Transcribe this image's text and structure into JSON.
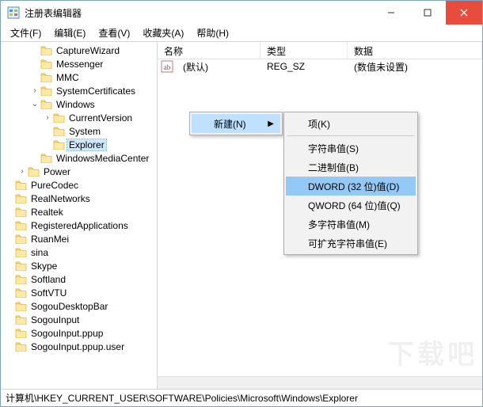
{
  "title": "注册表编辑器",
  "menu": {
    "file": "文件(F)",
    "edit": "编辑(E)",
    "view": "查看(V)",
    "favorites": "收藏夹(A)",
    "help": "帮助(H)"
  },
  "tree": [
    {
      "level": 2,
      "expander": "",
      "label": "CaptureWizard"
    },
    {
      "level": 2,
      "expander": "",
      "label": "Messenger"
    },
    {
      "level": 2,
      "expander": "",
      "label": "MMC"
    },
    {
      "level": 2,
      "expander": ">",
      "label": "SystemCertificates"
    },
    {
      "level": 2,
      "expander": "v",
      "label": "Windows"
    },
    {
      "level": 3,
      "expander": ">",
      "label": "CurrentVersion"
    },
    {
      "level": 3,
      "expander": "",
      "label": "System"
    },
    {
      "level": 3,
      "expander": "",
      "label": "Explorer",
      "selected": true
    },
    {
      "level": 2,
      "expander": "",
      "label": "WindowsMediaCenter"
    },
    {
      "level": 1,
      "expander": ">",
      "label": "Power"
    },
    {
      "level": 0,
      "expander": "",
      "label": "PureCodec"
    },
    {
      "level": 0,
      "expander": "",
      "label": "RealNetworks"
    },
    {
      "level": 0,
      "expander": "",
      "label": "Realtek"
    },
    {
      "level": 0,
      "expander": "",
      "label": "RegisteredApplications"
    },
    {
      "level": 0,
      "expander": "",
      "label": "RuanMei"
    },
    {
      "level": 0,
      "expander": "",
      "label": "sina"
    },
    {
      "level": 0,
      "expander": "",
      "label": "Skype"
    },
    {
      "level": 0,
      "expander": "",
      "label": "Softland"
    },
    {
      "level": 0,
      "expander": "",
      "label": "SoftVTU"
    },
    {
      "level": 0,
      "expander": "",
      "label": "SogouDesktopBar"
    },
    {
      "level": 0,
      "expander": "",
      "label": "SogouInput"
    },
    {
      "level": 0,
      "expander": "",
      "label": "SogouInput.ppup"
    },
    {
      "level": 0,
      "expander": "",
      "label": "SogouInput.ppup.user"
    }
  ],
  "columns": {
    "name": "名称",
    "type": "类型",
    "data": "数据"
  },
  "rows": [
    {
      "name": "(默认)",
      "type": "REG_SZ",
      "data": "(数值未设置)"
    }
  ],
  "context_primary": {
    "new": "新建(N)"
  },
  "context_sub": {
    "key": "项(K)",
    "string": "字符串值(S)",
    "binary": "二进制值(B)",
    "dword": "DWORD (32 位)值(D)",
    "qword": "QWORD (64 位)值(Q)",
    "multi": "多字符串值(M)",
    "expand": "可扩充字符串值(E)"
  },
  "statusbar": "计算机\\HKEY_CURRENT_USER\\SOFTWARE\\Policies\\Microsoft\\Windows\\Explorer",
  "watermark": "下载吧"
}
